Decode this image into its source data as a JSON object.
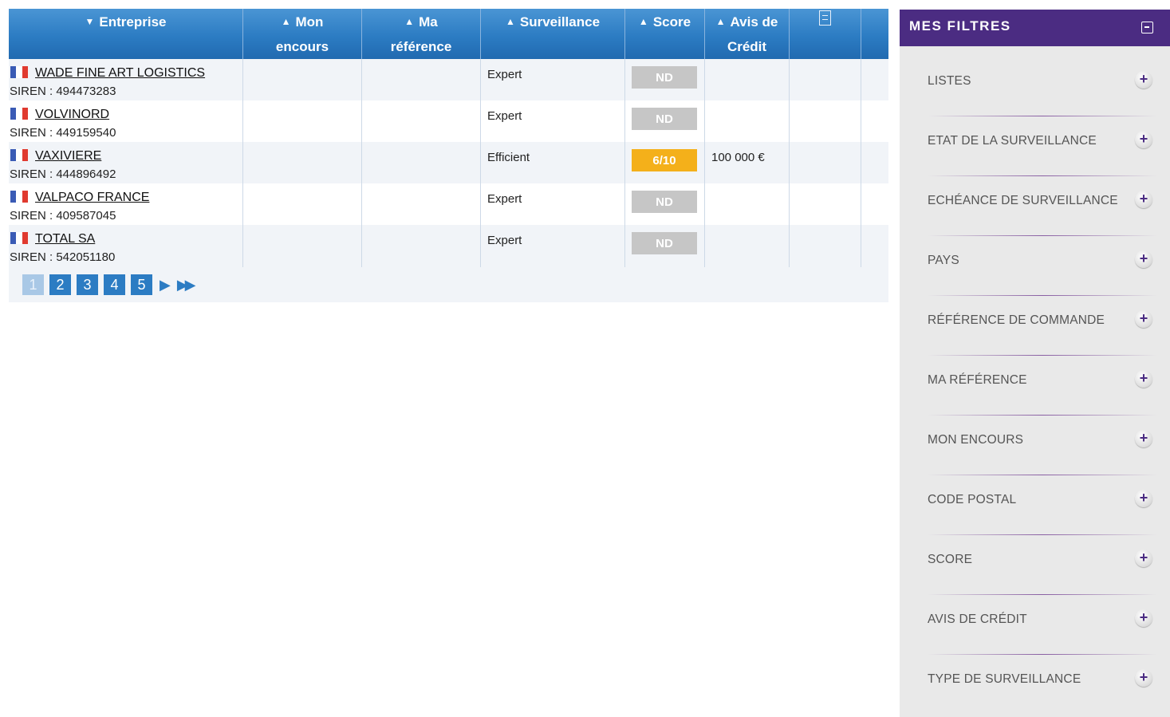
{
  "table": {
    "columns": [
      {
        "label": "Entreprise",
        "arrow": "▼"
      },
      {
        "label": "Mon encours",
        "arrow": "▲"
      },
      {
        "label": "Ma référence",
        "arrow": "▲"
      },
      {
        "label": "Surveillance",
        "arrow": "▲"
      },
      {
        "label": "Score",
        "arrow": "▲"
      },
      {
        "label": "Avis de Crédit",
        "arrow": "▲"
      },
      {
        "label": "",
        "icon": "document-icon"
      },
      {
        "label": ""
      }
    ],
    "header_lines": {
      "entreprise": "Entreprise",
      "mon_1": "Mon",
      "mon_2": "encours",
      "ma_1": "Ma",
      "ma_2": "référence",
      "surveillance": "Surveillance",
      "score": "Score",
      "avis_1": "Avis de",
      "avis_2": "Crédit"
    },
    "rows": [
      {
        "name": "WADE FINE ART LOGISTICS",
        "siren": "SIREN : 494473283",
        "surveillance": "Expert",
        "score": "ND",
        "score_type": "nd",
        "avis": ""
      },
      {
        "name": "VOLVINORD",
        "siren": "SIREN : 449159540",
        "surveillance": "Expert",
        "score": "ND",
        "score_type": "nd",
        "avis": ""
      },
      {
        "name": "VAXIVIERE",
        "siren": "SIREN : 444896492",
        "surveillance": "Efficient",
        "score": "6/10",
        "score_type": "ok",
        "avis": "100 000 €"
      },
      {
        "name": "VALPACO FRANCE",
        "siren": "SIREN : 409587045",
        "surveillance": "Expert",
        "score": "ND",
        "score_type": "nd",
        "avis": ""
      },
      {
        "name": "TOTAL SA",
        "siren": "SIREN : 542051180",
        "surveillance": "Expert",
        "score": "ND",
        "score_type": "nd",
        "avis": ""
      }
    ],
    "country_flag": "flag-france-icon"
  },
  "pagination": {
    "pages": [
      "1",
      "2",
      "3",
      "4",
      "5"
    ],
    "current": "1",
    "next": "▶",
    "last": "▶▶"
  },
  "filters": {
    "title": "MES FILTRES",
    "items": [
      "LISTES",
      "ETAT DE LA SURVEILLANCE",
      "ECHÉANCE DE SURVEILLANCE",
      "PAYS",
      "RÉFÉRENCE DE COMMANDE",
      "MA RÉFÉRENCE",
      "MON ENCOURS",
      "CODE POSTAL",
      "SCORE",
      "AVIS DE CRÉDIT",
      "TYPE DE SURVEILLANCE"
    ],
    "expand_symbol": "+"
  },
  "colors": {
    "header_blue": "#2c7cc3",
    "filter_purple": "#4b2c82",
    "score_ok": "#f4b01a",
    "score_nd": "#c6c6c6"
  }
}
